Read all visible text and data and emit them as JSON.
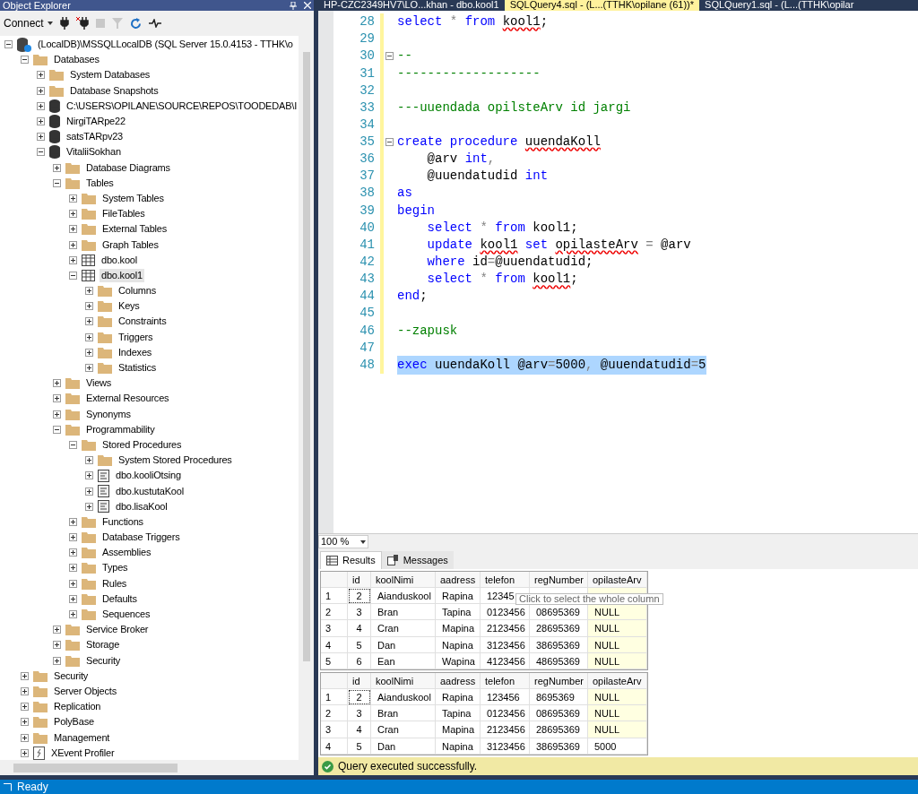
{
  "object_explorer": {
    "title": "Object Explorer",
    "toolbar": {
      "connect": "Connect"
    },
    "tree": [
      {
        "label": "(LocalDB)\\MSSQLLocalDB (SQL Server 15.0.4153 - TTHK\\o",
        "kind": "server",
        "expanded": true,
        "selected": false,
        "children": [
          {
            "label": "Databases",
            "kind": "folder",
            "expanded": true,
            "selected": false,
            "children": [
              {
                "label": "System Databases",
                "kind": "folder",
                "expanded": false,
                "selected": false
              },
              {
                "label": "Database Snapshots",
                "kind": "folder",
                "expanded": false,
                "selected": false
              },
              {
                "label": "C:\\USERS\\OPILANE\\SOURCE\\REPOS\\TOODEDAB\\I",
                "kind": "database",
                "expanded": false,
                "selected": false
              },
              {
                "label": "NirgiTARpe22",
                "kind": "database",
                "expanded": false,
                "selected": false
              },
              {
                "label": "satsTARpv23",
                "kind": "database",
                "expanded": false,
                "selected": false
              },
              {
                "label": "VitaliiSokhan",
                "kind": "database",
                "expanded": true,
                "selected": false,
                "children": [
                  {
                    "label": "Database Diagrams",
                    "kind": "folder",
                    "expanded": false,
                    "selected": false
                  },
                  {
                    "label": "Tables",
                    "kind": "folder",
                    "expanded": true,
                    "selected": false,
                    "children": [
                      {
                        "label": "System Tables",
                        "kind": "folder",
                        "expanded": false,
                        "selected": false
                      },
                      {
                        "label": "FileTables",
                        "kind": "folder",
                        "expanded": false,
                        "selected": false
                      },
                      {
                        "label": "External Tables",
                        "kind": "folder",
                        "expanded": false,
                        "selected": false
                      },
                      {
                        "label": "Graph Tables",
                        "kind": "folder",
                        "expanded": false,
                        "selected": false
                      },
                      {
                        "label": "dbo.kool",
                        "kind": "table",
                        "expanded": false,
                        "selected": false
                      },
                      {
                        "label": "dbo.kool1",
                        "kind": "table",
                        "expanded": true,
                        "selected": true,
                        "children": [
                          {
                            "label": "Columns",
                            "kind": "folder",
                            "expanded": false,
                            "selected": false
                          },
                          {
                            "label": "Keys",
                            "kind": "folder",
                            "expanded": false,
                            "selected": false
                          },
                          {
                            "label": "Constraints",
                            "kind": "folder",
                            "expanded": false,
                            "selected": false
                          },
                          {
                            "label": "Triggers",
                            "kind": "folder",
                            "expanded": false,
                            "selected": false
                          },
                          {
                            "label": "Indexes",
                            "kind": "folder",
                            "expanded": false,
                            "selected": false
                          },
                          {
                            "label": "Statistics",
                            "kind": "folder",
                            "expanded": false,
                            "selected": false
                          }
                        ]
                      }
                    ]
                  },
                  {
                    "label": "Views",
                    "kind": "folder",
                    "expanded": false,
                    "selected": false
                  },
                  {
                    "label": "External Resources",
                    "kind": "folder",
                    "expanded": false,
                    "selected": false
                  },
                  {
                    "label": "Synonyms",
                    "kind": "folder",
                    "expanded": false,
                    "selected": false
                  },
                  {
                    "label": "Programmability",
                    "kind": "folder",
                    "expanded": true,
                    "selected": false,
                    "children": [
                      {
                        "label": "Stored Procedures",
                        "kind": "folder",
                        "expanded": true,
                        "selected": false,
                        "children": [
                          {
                            "label": "System Stored Procedures",
                            "kind": "folder",
                            "expanded": false,
                            "selected": false
                          },
                          {
                            "label": "dbo.kooliOtsing",
                            "kind": "procedure",
                            "expanded": false,
                            "selected": false
                          },
                          {
                            "label": "dbo.kustutaKool",
                            "kind": "procedure",
                            "expanded": false,
                            "selected": false
                          },
                          {
                            "label": "dbo.lisaKool",
                            "kind": "procedure",
                            "expanded": false,
                            "selected": false
                          }
                        ]
                      },
                      {
                        "label": "Functions",
                        "kind": "folder",
                        "expanded": false,
                        "selected": false
                      },
                      {
                        "label": "Database Triggers",
                        "kind": "folder",
                        "expanded": false,
                        "selected": false
                      },
                      {
                        "label": "Assemblies",
                        "kind": "folder",
                        "expanded": false,
                        "selected": false
                      },
                      {
                        "label": "Types",
                        "kind": "folder",
                        "expanded": false,
                        "selected": false
                      },
                      {
                        "label": "Rules",
                        "kind": "folder",
                        "expanded": false,
                        "selected": false
                      },
                      {
                        "label": "Defaults",
                        "kind": "folder",
                        "expanded": false,
                        "selected": false
                      },
                      {
                        "label": "Sequences",
                        "kind": "folder",
                        "expanded": false,
                        "selected": false
                      }
                    ]
                  },
                  {
                    "label": "Service Broker",
                    "kind": "folder",
                    "expanded": false,
                    "selected": false
                  },
                  {
                    "label": "Storage",
                    "kind": "folder",
                    "expanded": false,
                    "selected": false
                  },
                  {
                    "label": "Security",
                    "kind": "folder",
                    "expanded": false,
                    "selected": false
                  }
                ]
              }
            ]
          },
          {
            "label": "Security",
            "kind": "folder",
            "expanded": false,
            "selected": false
          },
          {
            "label": "Server Objects",
            "kind": "folder",
            "expanded": false,
            "selected": false
          },
          {
            "label": "Replication",
            "kind": "folder",
            "expanded": false,
            "selected": false
          },
          {
            "label": "PolyBase",
            "kind": "folder",
            "expanded": false,
            "selected": false
          },
          {
            "label": "Management",
            "kind": "folder",
            "expanded": false,
            "selected": false
          },
          {
            "label": "XEvent Profiler",
            "kind": "profiler",
            "expanded": false,
            "selected": false
          }
        ]
      }
    ]
  },
  "tabs": [
    {
      "label": "HP-CZC2349HV7\\LO...khan - dbo.kool1",
      "selected": false
    },
    {
      "label": "SQLQuery4.sql - (L...(TTHK\\opilane (61))*",
      "selected": true
    },
    {
      "label": "SQLQuery1.sql - (L...(TTHK\\opilar",
      "selected": false
    }
  ],
  "editor": {
    "lines": [
      {
        "number": "28",
        "collapsible": false,
        "selected": false,
        "tokens": [
          {
            "text": "select",
            "kind": "keyword"
          },
          {
            "text": " * ",
            "kind": "operator"
          },
          {
            "text": "from ",
            "kind": "keyword"
          },
          {
            "text": "kool1",
            "kind": "error"
          },
          {
            "text": ";",
            "kind": "plain"
          }
        ]
      },
      {
        "number": "29",
        "collapsible": false,
        "selected": false
      },
      {
        "number": "30",
        "collapsible": true,
        "selected": false,
        "tokens": [
          {
            "text": "--",
            "kind": "comment"
          }
        ]
      },
      {
        "number": "31",
        "collapsible": false,
        "selected": false,
        "tokens": [
          {
            "text": "-------------------",
            "kind": "comment"
          }
        ]
      },
      {
        "number": "32",
        "collapsible": false,
        "selected": false
      },
      {
        "number": "33",
        "collapsible": false,
        "selected": false,
        "tokens": [
          {
            "text": "---uuendada opilsteArv id jargi",
            "kind": "comment"
          }
        ]
      },
      {
        "number": "34",
        "collapsible": false,
        "selected": false
      },
      {
        "number": "35",
        "collapsible": true,
        "selected": false,
        "tokens": [
          {
            "text": "create procedure ",
            "kind": "keyword"
          },
          {
            "text": "uuendaKoll",
            "kind": "error"
          }
        ]
      },
      {
        "number": "36",
        "collapsible": false,
        "selected": false,
        "tokens": [
          {
            "text": "    @arv ",
            "kind": "plain"
          },
          {
            "text": "int",
            "kind": "keyword"
          },
          {
            "text": ",",
            "kind": "operator"
          }
        ]
      },
      {
        "number": "37",
        "collapsible": false,
        "selected": false,
        "tokens": [
          {
            "text": "    @uuendatudid ",
            "kind": "plain"
          },
          {
            "text": "int",
            "kind": "keyword"
          }
        ]
      },
      {
        "number": "38",
        "collapsible": false,
        "selected": false,
        "tokens": [
          {
            "text": "as",
            "kind": "keyword"
          }
        ]
      },
      {
        "number": "39",
        "collapsible": false,
        "selected": false,
        "tokens": [
          {
            "text": "begin",
            "kind": "keyword"
          }
        ]
      },
      {
        "number": "40",
        "collapsible": false,
        "selected": false,
        "tokens": [
          {
            "text": "    select",
            "kind": "keyword"
          },
          {
            "text": " * ",
            "kind": "operator"
          },
          {
            "text": "from",
            "kind": "keyword"
          },
          {
            "text": " kool1",
            "kind": "plain"
          },
          {
            "text": ";",
            "kind": "plain"
          }
        ]
      },
      {
        "number": "41",
        "collapsible": false,
        "selected": false,
        "tokens": [
          {
            "text": "    update ",
            "kind": "keyword"
          },
          {
            "text": "kool1",
            "kind": "error"
          },
          {
            "text": " set ",
            "kind": "keyword"
          },
          {
            "text": "opilasteArv",
            "kind": "error"
          },
          {
            "text": " = ",
            "kind": "operator"
          },
          {
            "text": "@arv",
            "kind": "plain"
          }
        ]
      },
      {
        "number": "42",
        "collapsible": false,
        "selected": false,
        "tokens": [
          {
            "text": "    where",
            "kind": "keyword"
          },
          {
            "text": " id",
            "kind": "plain"
          },
          {
            "text": "=",
            "kind": "operator"
          },
          {
            "text": "@uuendatudid",
            "kind": "plain"
          },
          {
            "text": ";",
            "kind": "plain"
          }
        ]
      },
      {
        "number": "43",
        "collapsible": false,
        "selected": false,
        "tokens": [
          {
            "text": "    select",
            "kind": "keyword"
          },
          {
            "text": " * ",
            "kind": "operator"
          },
          {
            "text": "from ",
            "kind": "keyword"
          },
          {
            "text": "kool1",
            "kind": "error"
          },
          {
            "text": ";",
            "kind": "plain"
          }
        ]
      },
      {
        "number": "44",
        "collapsible": false,
        "selected": false,
        "tokens": [
          {
            "text": "end",
            "kind": "keyword"
          },
          {
            "text": ";",
            "kind": "plain"
          }
        ]
      },
      {
        "number": "45",
        "collapsible": false,
        "selected": false
      },
      {
        "number": "46",
        "collapsible": false,
        "selected": false,
        "tokens": [
          {
            "text": "--zapusk",
            "kind": "comment"
          }
        ]
      },
      {
        "number": "47",
        "collapsible": false,
        "selected": false
      },
      {
        "number": "48",
        "collapsible": false,
        "selected": true,
        "tokens": [
          {
            "text": "exec",
            "kind": "keyword"
          },
          {
            "text": " uuendaKoll @arv",
            "kind": "plain"
          },
          {
            "text": "=",
            "kind": "operator"
          },
          {
            "text": "5000",
            "kind": "plain"
          },
          {
            "text": ", ",
            "kind": "operator"
          },
          {
            "text": "@uuendatudid",
            "kind": "plain"
          },
          {
            "text": "=",
            "kind": "operator"
          },
          {
            "text": "5",
            "kind": "plain"
          }
        ]
      }
    ]
  },
  "zoom": "100 %",
  "result_tabs": [
    {
      "label": "Results",
      "kind": "grid",
      "selected": true
    },
    {
      "label": "Messages",
      "kind": "messages",
      "selected": false
    }
  ],
  "grids": [
    {
      "columns": [
        "id",
        "koolNimi",
        "aadress",
        "telefon",
        "regNumber",
        "opilasteArv"
      ],
      "rows": [
        {
          "number": "1",
          "focused": true,
          "null_value": true,
          "cells": [
            "2",
            "Aianduskool",
            "Rapina",
            "12345"
          ]
        },
        {
          "number": "2",
          "focused": false,
          "null_value": true,
          "cells": [
            "3",
            "Bran",
            "Tapina",
            "0123456",
            "08695369",
            "NULL"
          ]
        },
        {
          "number": "3",
          "focused": false,
          "null_value": true,
          "cells": [
            "4",
            "Cran",
            "Mapina",
            "2123456",
            "28695369",
            "NULL"
          ]
        },
        {
          "number": "4",
          "focused": false,
          "null_value": true,
          "cells": [
            "5",
            "Dan",
            "Napina",
            "3123456",
            "38695369",
            "NULL"
          ]
        },
        {
          "number": "5",
          "focused": false,
          "null_value": true,
          "cells": [
            "6",
            "Ean",
            "Wapina",
            "4123456",
            "48695369",
            "NULL"
          ]
        }
      ]
    },
    {
      "columns": [
        "id",
        "koolNimi",
        "aadress",
        "telefon",
        "regNumber",
        "opilasteArv"
      ],
      "rows": [
        {
          "number": "1",
          "focused": true,
          "null_value": true,
          "cells": [
            "2",
            "Aianduskool",
            "Rapina",
            "123456",
            "8695369",
            "NULL"
          ]
        },
        {
          "number": "2",
          "focused": false,
          "null_value": true,
          "cells": [
            "3",
            "Bran",
            "Tapina",
            "0123456",
            "08695369",
            "NULL"
          ]
        },
        {
          "number": "3",
          "focused": false,
          "null_value": true,
          "cells": [
            "4",
            "Cran",
            "Mapina",
            "2123456",
            "28695369",
            "NULL"
          ]
        },
        {
          "number": "4",
          "focused": false,
          "null_value": false,
          "cells": [
            "5",
            "Dan",
            "Napina",
            "3123456",
            "38695369",
            "5000"
          ]
        }
      ]
    }
  ],
  "tooltip": "Click to select the whole column",
  "query_status": "Query executed successfully.",
  "status_bar": "Ready"
}
